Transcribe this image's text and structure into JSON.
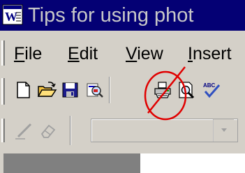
{
  "window": {
    "title": "Tips for using phot",
    "app_icon": "word-document-icon"
  },
  "menu": {
    "items": [
      {
        "mnemonic": "F",
        "rest": "ile",
        "name": "menu-file"
      },
      {
        "mnemonic": "E",
        "rest": "dit",
        "name": "menu-edit"
      },
      {
        "mnemonic": "V",
        "rest": "iew",
        "name": "menu-view"
      },
      {
        "mnemonic": "I",
        "rest": "nsert",
        "name": "menu-insert"
      }
    ]
  },
  "toolbar": {
    "buttons": [
      "new-document-icon",
      "open-folder-icon",
      "save-floppy-icon",
      "permission-search-icon",
      "print-icon",
      "print-preview-icon",
      "spelling-abc-icon"
    ],
    "crossed_out_button": "print-icon",
    "annotation_color": "#e00000"
  },
  "drawing_toolbar": {
    "buttons": [
      "pen-draw-icon",
      "eraser-icon"
    ],
    "style_combo": {
      "value": ""
    }
  },
  "colors": {
    "titlebar": "#040074",
    "title_text": "#c8c8c8",
    "chrome": "#d4d0c8"
  }
}
